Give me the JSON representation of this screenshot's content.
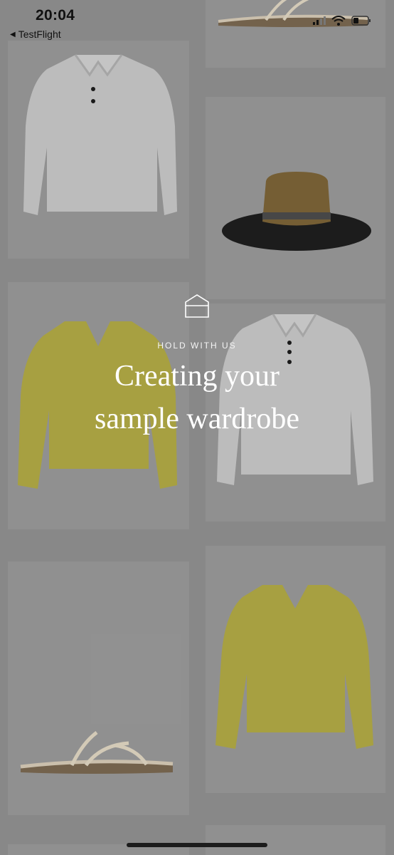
{
  "status_bar": {
    "time": "20:04",
    "back_label": "TestFlight",
    "icons": [
      "signal-icon",
      "wifi-icon",
      "battery-icon"
    ]
  },
  "overlay": {
    "icon": "house-icon",
    "eyebrow": "HOLD WITH US",
    "title_line1": "Creating your",
    "title_line2": "sample wardrobe"
  },
  "grid": {
    "items": [
      {
        "product": "sandal",
        "color": "#d8cdb8"
      },
      {
        "product": "polo-sweater",
        "color": "#c8c8c8"
      },
      {
        "product": "straw-hat",
        "color": "#1a1a1a"
      },
      {
        "product": "vneck-sweater",
        "color": "#b5ad4a"
      },
      {
        "product": "polo-sweater",
        "color": "#c8c8c8"
      },
      {
        "product": "sandal",
        "color": "#d8cdb8"
      },
      {
        "product": "vneck-sweater",
        "color": "#b5ad4a"
      }
    ]
  }
}
